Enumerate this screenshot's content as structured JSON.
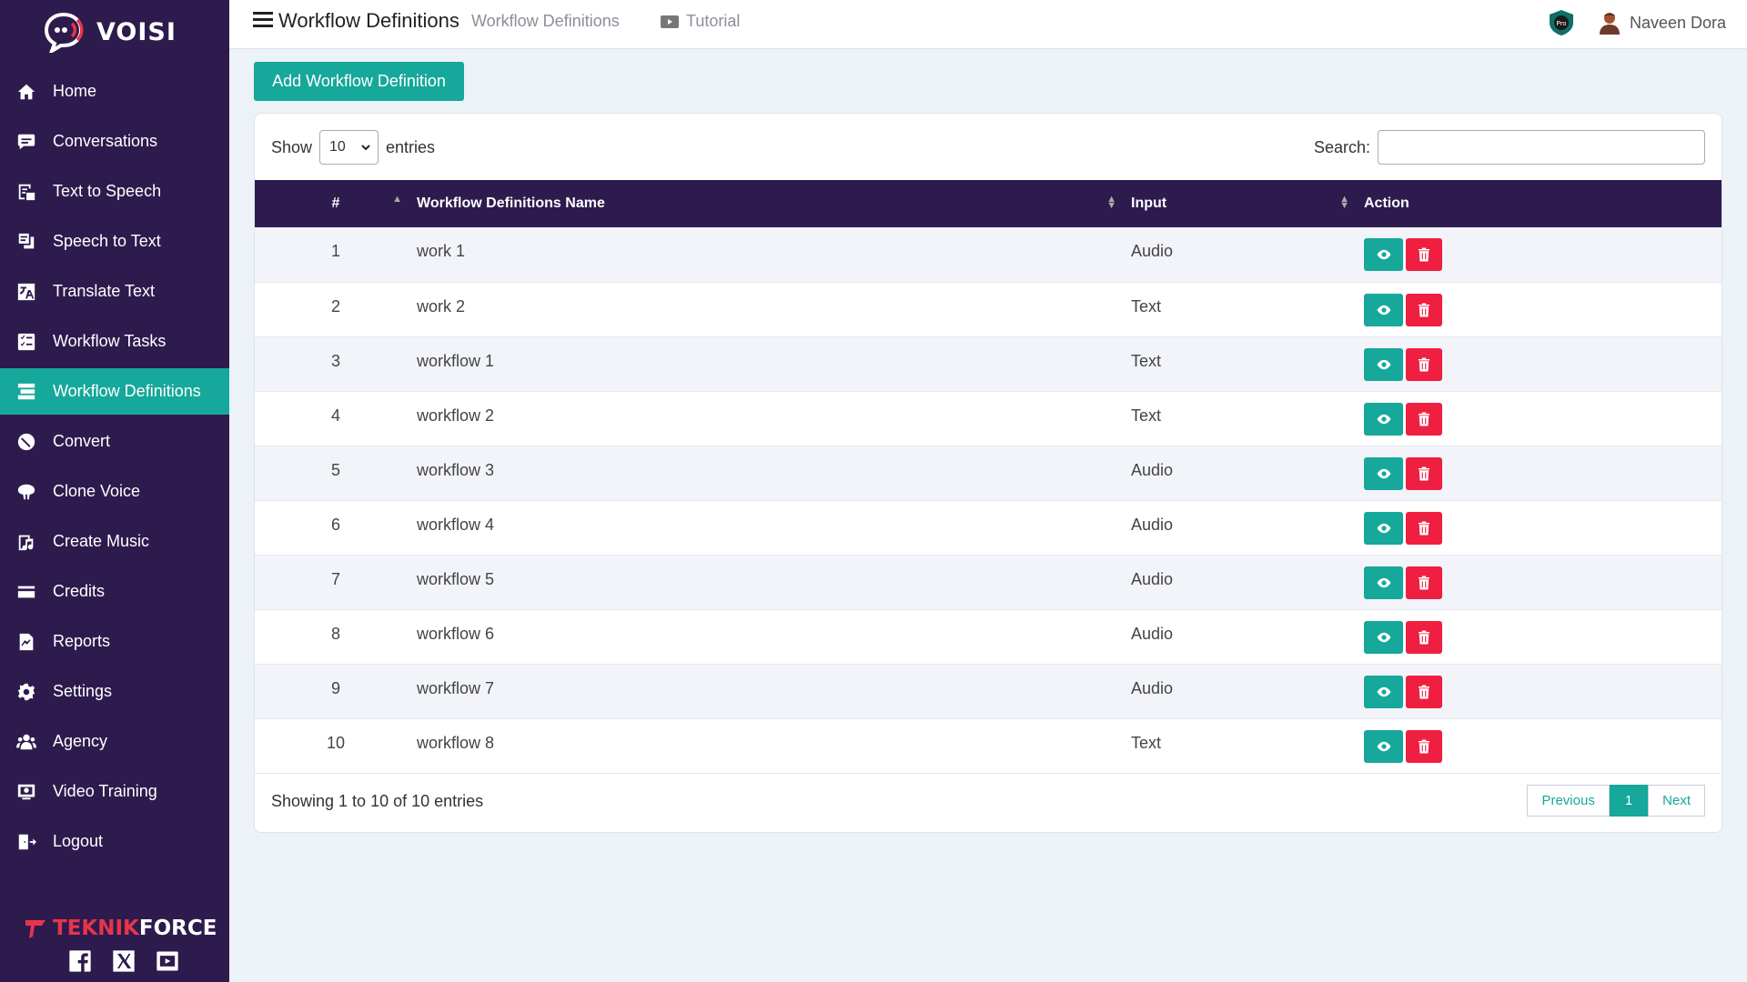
{
  "brand": {
    "name": "VOISI"
  },
  "sidebar": {
    "items": [
      {
        "label": "Home",
        "icon": "home-icon"
      },
      {
        "label": "Conversations",
        "icon": "chat-icon"
      },
      {
        "label": "Text to Speech",
        "icon": "text-to-speech-icon"
      },
      {
        "label": "Speech to Text",
        "icon": "speech-to-text-icon"
      },
      {
        "label": "Translate Text",
        "icon": "translate-icon"
      },
      {
        "label": "Workflow Tasks",
        "icon": "tasks-icon"
      },
      {
        "label": "Workflow Definitions",
        "icon": "workflow-icon",
        "active": true
      },
      {
        "label": "Convert",
        "icon": "convert-icon"
      },
      {
        "label": "Clone Voice",
        "icon": "clone-voice-icon"
      },
      {
        "label": "Create Music",
        "icon": "music-icon"
      },
      {
        "label": "Credits",
        "icon": "credit-card-icon"
      },
      {
        "label": "Reports",
        "icon": "reports-icon"
      },
      {
        "label": "Settings",
        "icon": "gear-icon"
      },
      {
        "label": "Agency",
        "icon": "users-icon"
      },
      {
        "label": "Video Training",
        "icon": "video-icon"
      },
      {
        "label": "Logout",
        "icon": "logout-icon"
      }
    ],
    "footer_brand_part1": "TEKNIK",
    "footer_brand_part2": "FORCE"
  },
  "header": {
    "title": "Workflow Definitions",
    "breadcrumb": "Workflow Definitions",
    "tutorial": "Tutorial",
    "user_name": "Naveen Dora"
  },
  "main": {
    "add_button": "Add Workflow Definition",
    "show_label": "Show",
    "entries_label": "entries",
    "page_size": "10",
    "search_label": "Search:",
    "search_value": "",
    "columns": [
      "#",
      "Workflow Definitions Name",
      "Input",
      "Action"
    ],
    "rows": [
      {
        "num": "1",
        "name": "work 1",
        "input": "Audio"
      },
      {
        "num": "2",
        "name": "work 2",
        "input": "Text"
      },
      {
        "num": "3",
        "name": "workflow 1",
        "input": "Text"
      },
      {
        "num": "4",
        "name": "workflow 2",
        "input": "Text"
      },
      {
        "num": "5",
        "name": "workflow 3",
        "input": "Audio"
      },
      {
        "num": "6",
        "name": "workflow 4",
        "input": "Audio"
      },
      {
        "num": "7",
        "name": "workflow 5",
        "input": "Audio"
      },
      {
        "num": "8",
        "name": "workflow 6",
        "input": "Audio"
      },
      {
        "num": "9",
        "name": "workflow 7",
        "input": "Audio"
      },
      {
        "num": "10",
        "name": "workflow 8",
        "input": "Text"
      }
    ],
    "info": "Showing 1 to 10 of 10 entries",
    "pagination": {
      "previous": "Previous",
      "current": "1",
      "next": "Next"
    }
  },
  "colors": {
    "sidebar_bg": "#2d1b4e",
    "accent": "#16a89a",
    "danger": "#ee1f40",
    "page_bg": "#edf1f8"
  }
}
